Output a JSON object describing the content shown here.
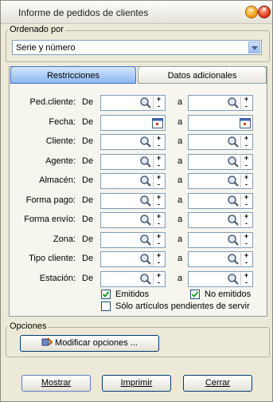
{
  "window": {
    "title": "Informe de pedidos de clientes"
  },
  "sort_group": {
    "legend": "Ordenado por",
    "selected": "Serie y número"
  },
  "tabs": [
    {
      "label": "Restricciones",
      "active": true
    },
    {
      "label": "Datos adicionales",
      "active": false
    }
  ],
  "range_labels": {
    "from": "De",
    "to": "a"
  },
  "restrictions": [
    {
      "label": "Ped.cliente:",
      "kind": "search"
    },
    {
      "label": "Fecha:",
      "kind": "date"
    },
    {
      "label": "Cliente:",
      "kind": "search"
    },
    {
      "label": "Agente:",
      "kind": "search"
    },
    {
      "label": "Almacén:",
      "kind": "search"
    },
    {
      "label": "Forma pago:",
      "kind": "search"
    },
    {
      "label": "Forma envío:",
      "kind": "search"
    },
    {
      "label": "Zona:",
      "kind": "search"
    },
    {
      "label": "Tipo cliente:",
      "kind": "search"
    },
    {
      "label": "Estación:",
      "kind": "search"
    }
  ],
  "checkboxes": {
    "emitidos": {
      "label": "Emitidos",
      "checked": true
    },
    "no_emitidos": {
      "label": "No emitidos",
      "checked": true
    },
    "pendientes": {
      "label": "Sólo artículos pendientes  de servir",
      "checked": false
    }
  },
  "options_group": {
    "legend": "Opciones",
    "modify_label": "Modificar opciones ..."
  },
  "footer": {
    "mostrar": "Mostrar",
    "imprimir": "Imprimir",
    "cerrar": "Cerrar"
  },
  "colors": {
    "tab_active": "#8cb8f0",
    "check_green": "#21a121",
    "accent_border": "#003c74"
  }
}
